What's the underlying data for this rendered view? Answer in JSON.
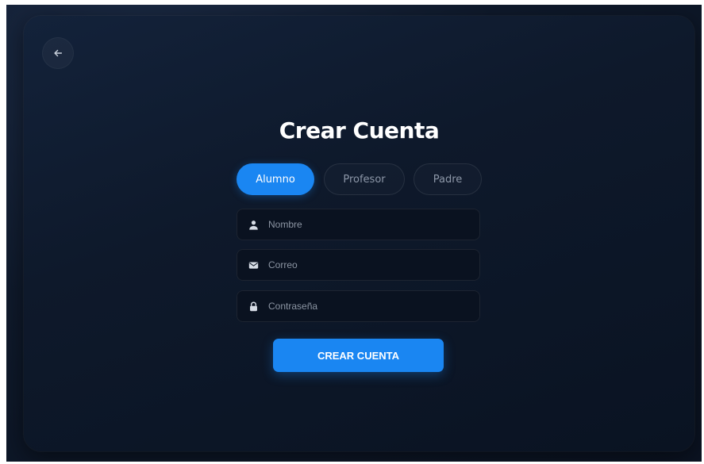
{
  "page": {
    "title": "Crear Cuenta"
  },
  "navigation": {
    "back_icon": "arrow-left-icon"
  },
  "roles": {
    "options": [
      "Alumno",
      "Profesor",
      "Padre"
    ],
    "selected": "Alumno"
  },
  "form": {
    "name": {
      "placeholder": "Nombre",
      "value": "",
      "icon": "user-icon"
    },
    "email": {
      "placeholder": "Correo",
      "value": "",
      "icon": "envelope-icon"
    },
    "password": {
      "placeholder": "Contraseña",
      "value": "",
      "icon": "lock-icon"
    }
  },
  "submit": {
    "label": "CREAR CUENTA"
  },
  "colors": {
    "accent": "#1a86f2",
    "background": "#0e192b",
    "field_background": "#0a1220",
    "text": "#ffffff",
    "muted_text": "#8d97a8"
  }
}
